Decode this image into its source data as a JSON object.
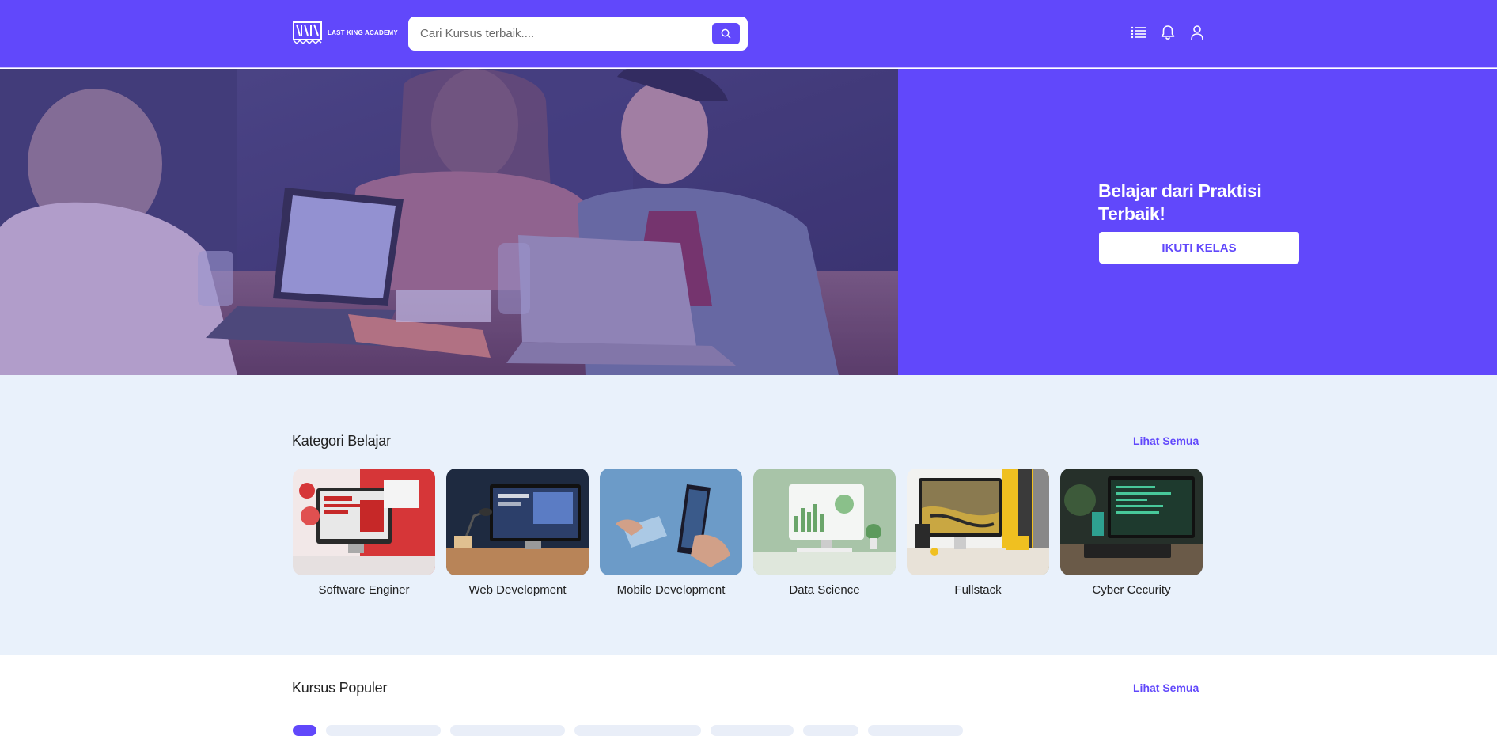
{
  "header": {
    "brand": "LAST KING ACADEMY",
    "search_placeholder": "Cari Kursus terbaik....",
    "icons": [
      "search-icon",
      "list-icon",
      "bell-icon",
      "user-icon"
    ]
  },
  "hero": {
    "title": "Belajar dari Praktisi Terbaik!",
    "button": "IKUTI KELAS"
  },
  "kategori": {
    "title": "Kategori Belajar",
    "see_all": "Lihat Semua",
    "items": [
      {
        "label": "Software Enginer"
      },
      {
        "label": "Web Development"
      },
      {
        "label": "Mobile Development"
      },
      {
        "label": "Data Science"
      },
      {
        "label": "Fullstack"
      },
      {
        "label": "Cyber Cecurity"
      }
    ]
  },
  "populer": {
    "title": "Kursus Populer",
    "see_all": "Lihat Semua"
  },
  "colors": {
    "primary": "#6148fb",
    "section_bg": "#e9f1fb"
  }
}
